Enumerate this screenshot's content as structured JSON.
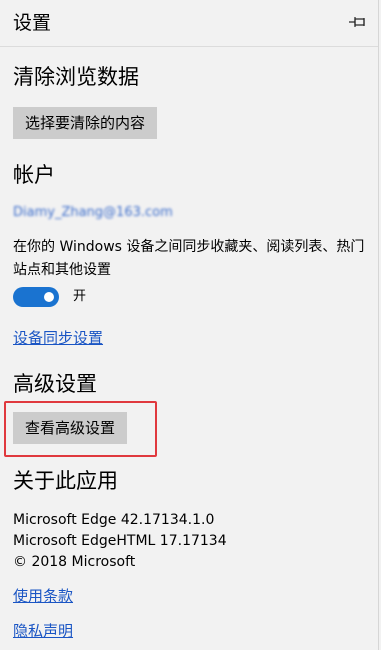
{
  "header": {
    "title": "设置",
    "pin_icon": "pin-icon"
  },
  "clear_data": {
    "title": "清除浏览数据",
    "button_label": "选择要清除的内容"
  },
  "account": {
    "title": "帐户",
    "email": "Diamy_Zhang@163.com",
    "sync_description": "在你的 Windows 设备之间同步收藏夹、阅读列表、热门站点和其他设置",
    "toggle_state": "开",
    "sync_link": "设备同步设置"
  },
  "advanced": {
    "title": "高级设置",
    "button_label": "查看高级设置"
  },
  "about": {
    "title": "关于此应用",
    "edge_version": "Microsoft Edge 42.17134.1.0",
    "edgehtml_version": "Microsoft EdgeHTML 17.17134",
    "copyright": "© 2018 Microsoft",
    "terms_link": "使用条款",
    "privacy_link": "隐私声明"
  },
  "colors": {
    "accent": "#1a73d0",
    "link": "#1a55c4",
    "highlight": "#e0393e",
    "button_bg": "#cccccc",
    "panel_bg": "#f2f2f2"
  }
}
